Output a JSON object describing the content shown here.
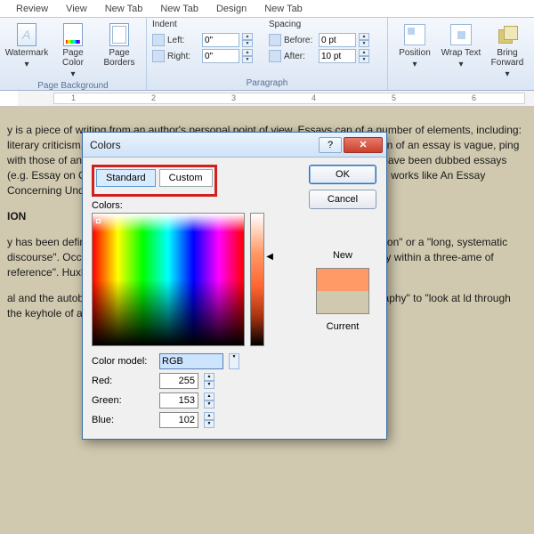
{
  "tabs": [
    "Review",
    "View",
    "New Tab",
    "New Tab",
    "Design",
    "New Tab"
  ],
  "ribbon": {
    "page_bg": {
      "watermark": "Watermark",
      "page_color": "Page Color",
      "borders": "Page Borders",
      "label": "Page Background"
    },
    "indent": {
      "head": "Indent",
      "left": "Left:",
      "left_val": "0\"",
      "right": "Right:",
      "right_val": "0\""
    },
    "spacing": {
      "head": "Spacing",
      "before": "Before:",
      "before_val": "0 pt",
      "after": "After:",
      "after_val": "10 pt"
    },
    "paragraph_label": "Paragraph",
    "arrange": {
      "position": "Position",
      "wrap": "Wrap Text",
      "forward": "Bring Forward"
    }
  },
  "ruler": [
    "1",
    "2",
    "3",
    "4",
    "5",
    "6"
  ],
  "doc": {
    "p1": "y is a piece of writing from an author's personal point of view. Essays can of a number of elements, including: literary criticism, learned arguments, tions of daily life, recollections. The definition of an essay is vague, ping with those of an article and a short story. Essays are written in prose, but verse have been dubbed essays (e.g. Essay on Criticism and An Essay on While brevity usually defines an essay, works like An Essay Concerning Understanding and An Essay on Population are examples.",
    "h1": "ION",
    "p2": "y has been defined in a variety of ways. A composition with a focused of discussion\" or a \"long, systematic discourse\". Occasions that \"essays to a literary species whose extreme variability within a three-ame of reference\". Huxley's three poles are:",
    "p3": "al and the autobiographical essays: these use \"fragments of reflective autobiography\" to \"look at ld through the keyhole of anecdote and description\"."
  },
  "dialog": {
    "title": "Colors",
    "tab_standard": "Standard",
    "tab_custom": "Custom",
    "ok": "OK",
    "cancel": "Cancel",
    "colors_label": "Colors:",
    "model_label": "Color model:",
    "model_value": "RGB",
    "red_label": "Red:",
    "red": "255",
    "green_label": "Green:",
    "green": "153",
    "blue_label": "Blue:",
    "blue": "102",
    "new": "New",
    "current": "Current"
  }
}
